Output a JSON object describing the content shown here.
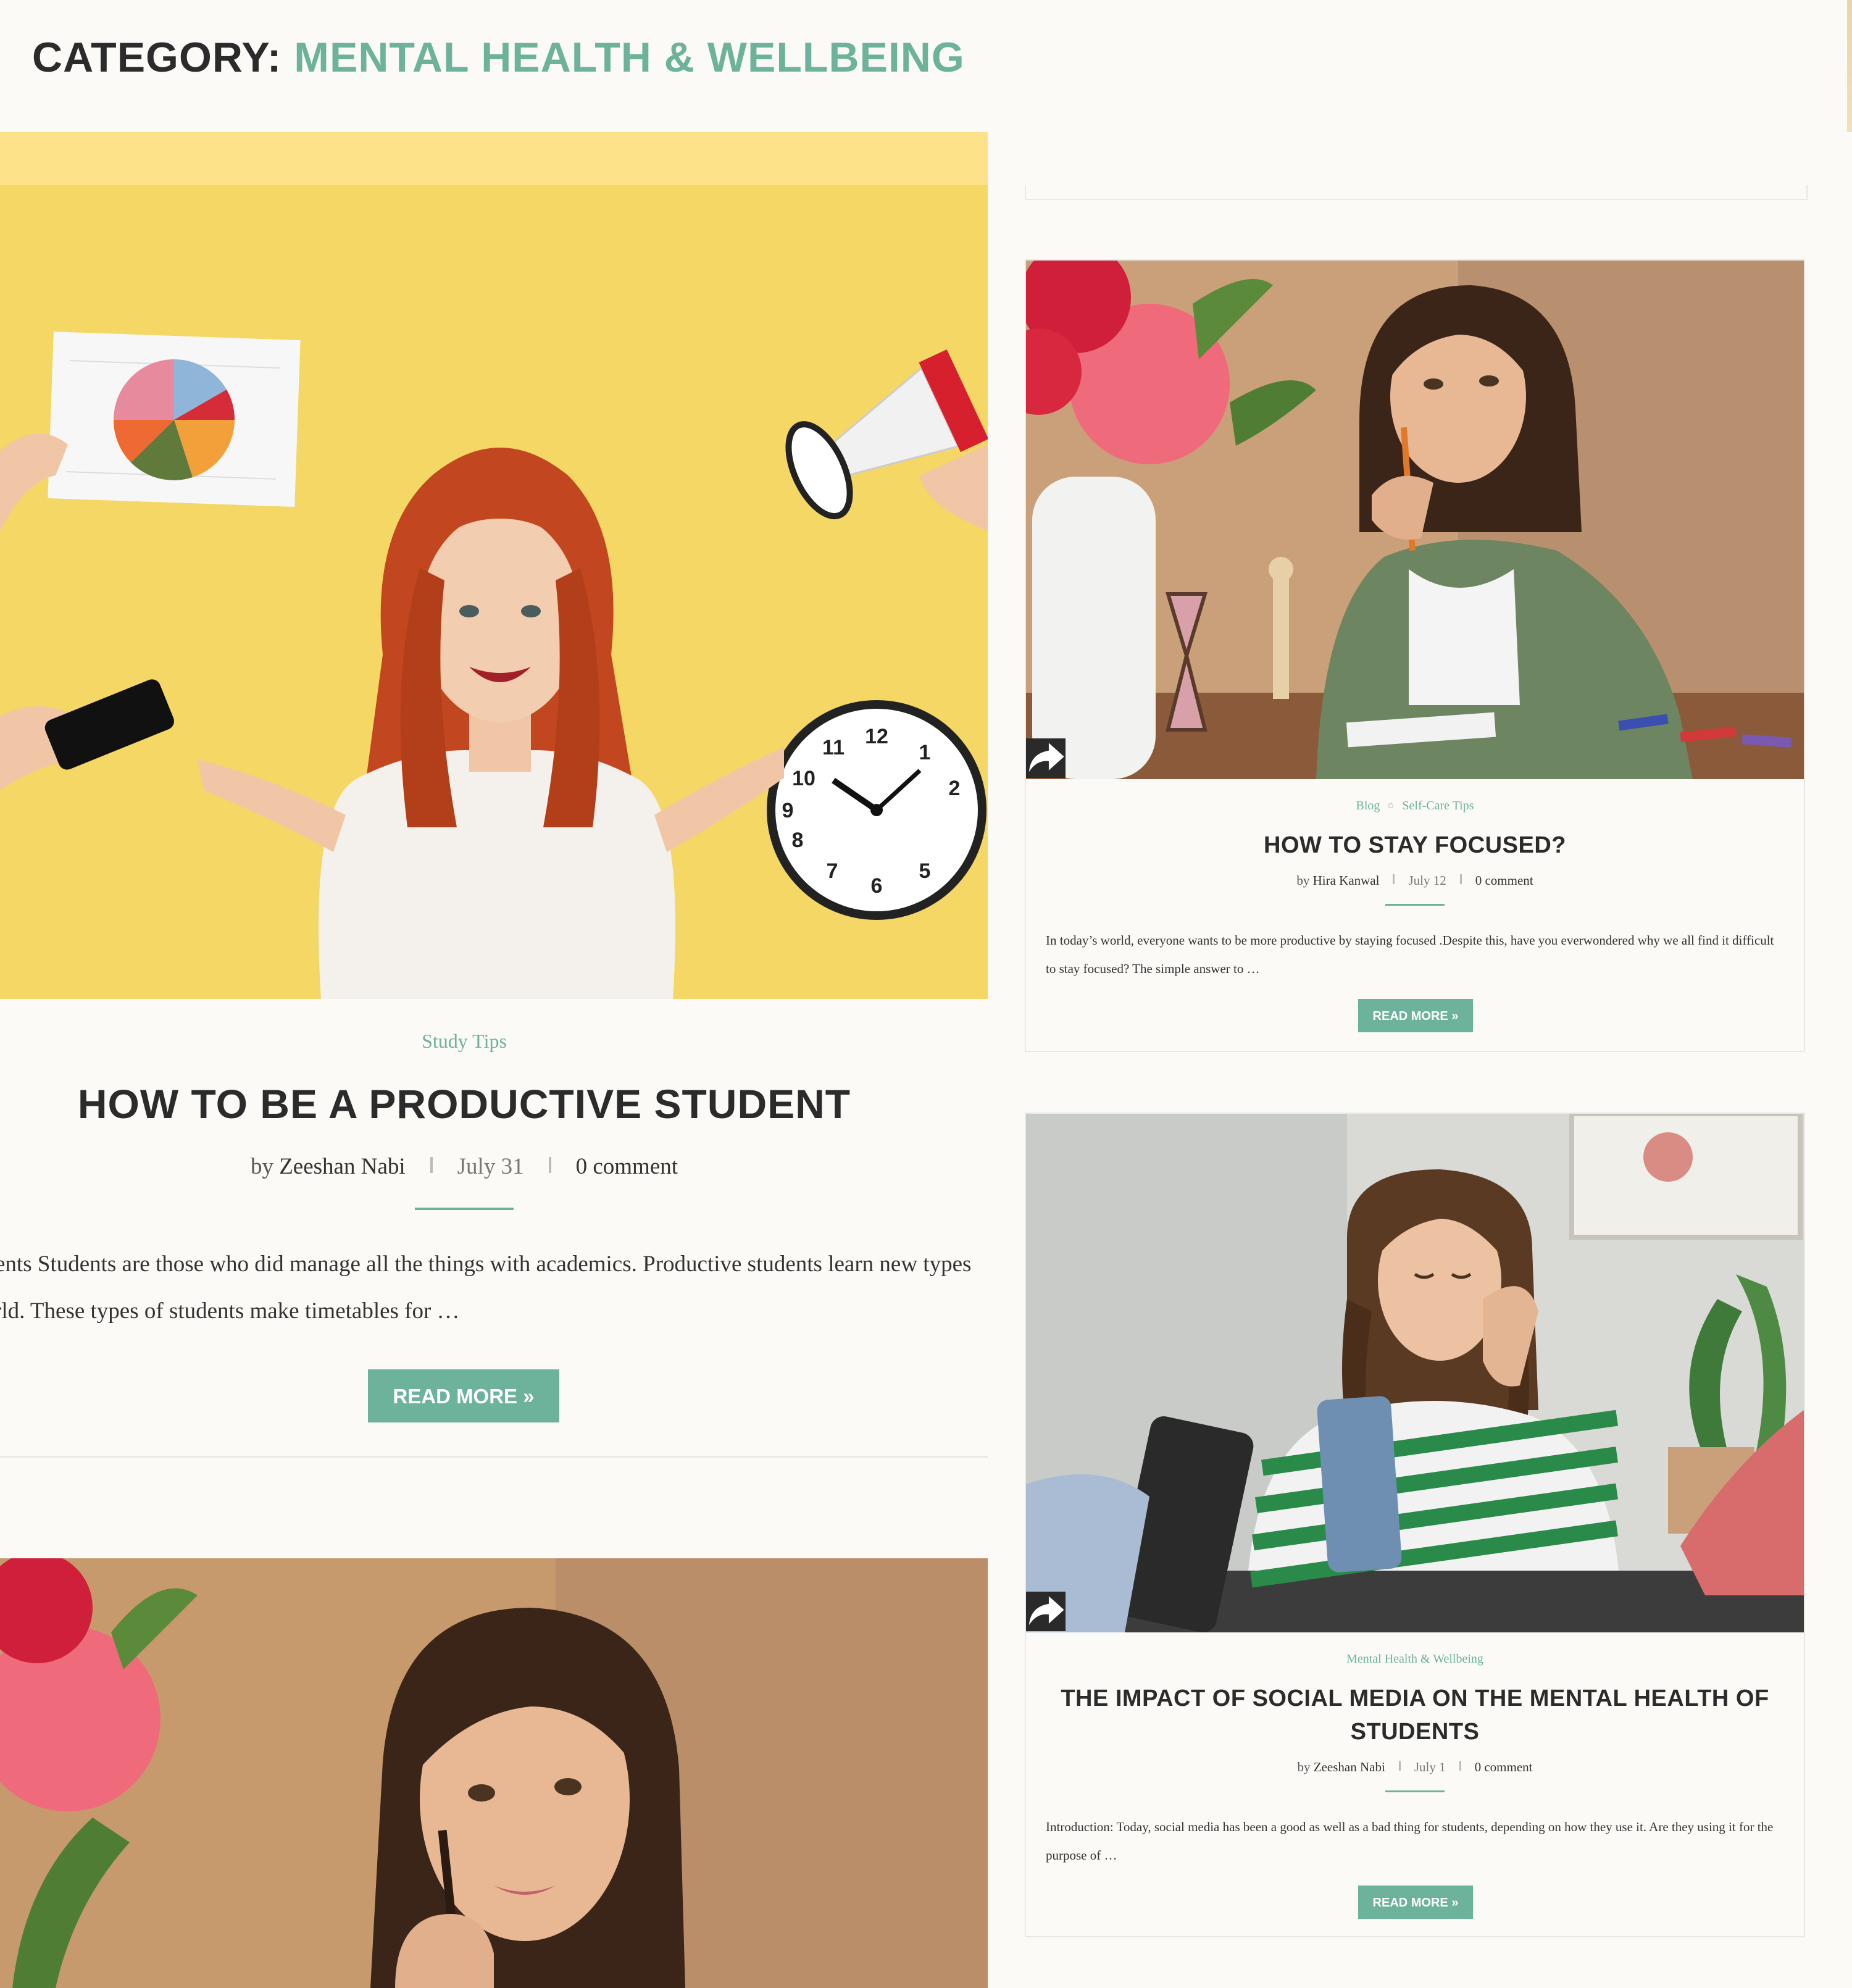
{
  "header": {
    "label": "CATEGORY:",
    "category_name": "MENTAL HEALTH & WELLBEING"
  },
  "featured_post": {
    "category": "Study Tips",
    "title": "HOW TO BE A PRODUCTIVE STUDENT",
    "author_prefix": "by",
    "author": "Zeeshan Nabi",
    "date": "July 31",
    "comments": "0 comment",
    "excerpt_line_1": "ents Students are those who did manage all the things with academics. Productive students learn new types",
    "excerpt_line_2": "rld. These types of students make timetables for …",
    "read_more": "READ MORE »"
  },
  "cards": [
    {
      "categories": [
        "Blog",
        "Self-Care Tips"
      ],
      "title": "HOW TO STAY FOCUSED?",
      "author_prefix": "by",
      "author": "Hira Kanwal",
      "date": "July 12",
      "comments": "0 comment",
      "excerpt": "In today’s world, everyone wants to be more productive by staying focused .Despite this, have you everwondered why we all find it difficult to stay focused? The simple answer to …",
      "read_more": "READ MORE »"
    },
    {
      "categories": [
        "Mental Health & Wellbeing"
      ],
      "title": "THE IMPACT OF SOCIAL MEDIA ON THE MENTAL HEALTH OF STUDENTS",
      "author_prefix": "by",
      "author": "Zeeshan Nabi",
      "date": "July 1",
      "comments": "0 comment",
      "excerpt": "Introduction: Today, social media has been a good as well as a bad thing for students, depending on how they use it. Are they using it for the purpose of …",
      "read_more": "READ MORE »"
    }
  ],
  "colors": {
    "accent": "#6db29a",
    "text": "#2b2b2b",
    "background": "#fbfaf7",
    "featured_background": "#f5d766"
  },
  "icons": {
    "share": "share-arrow-icon"
  }
}
